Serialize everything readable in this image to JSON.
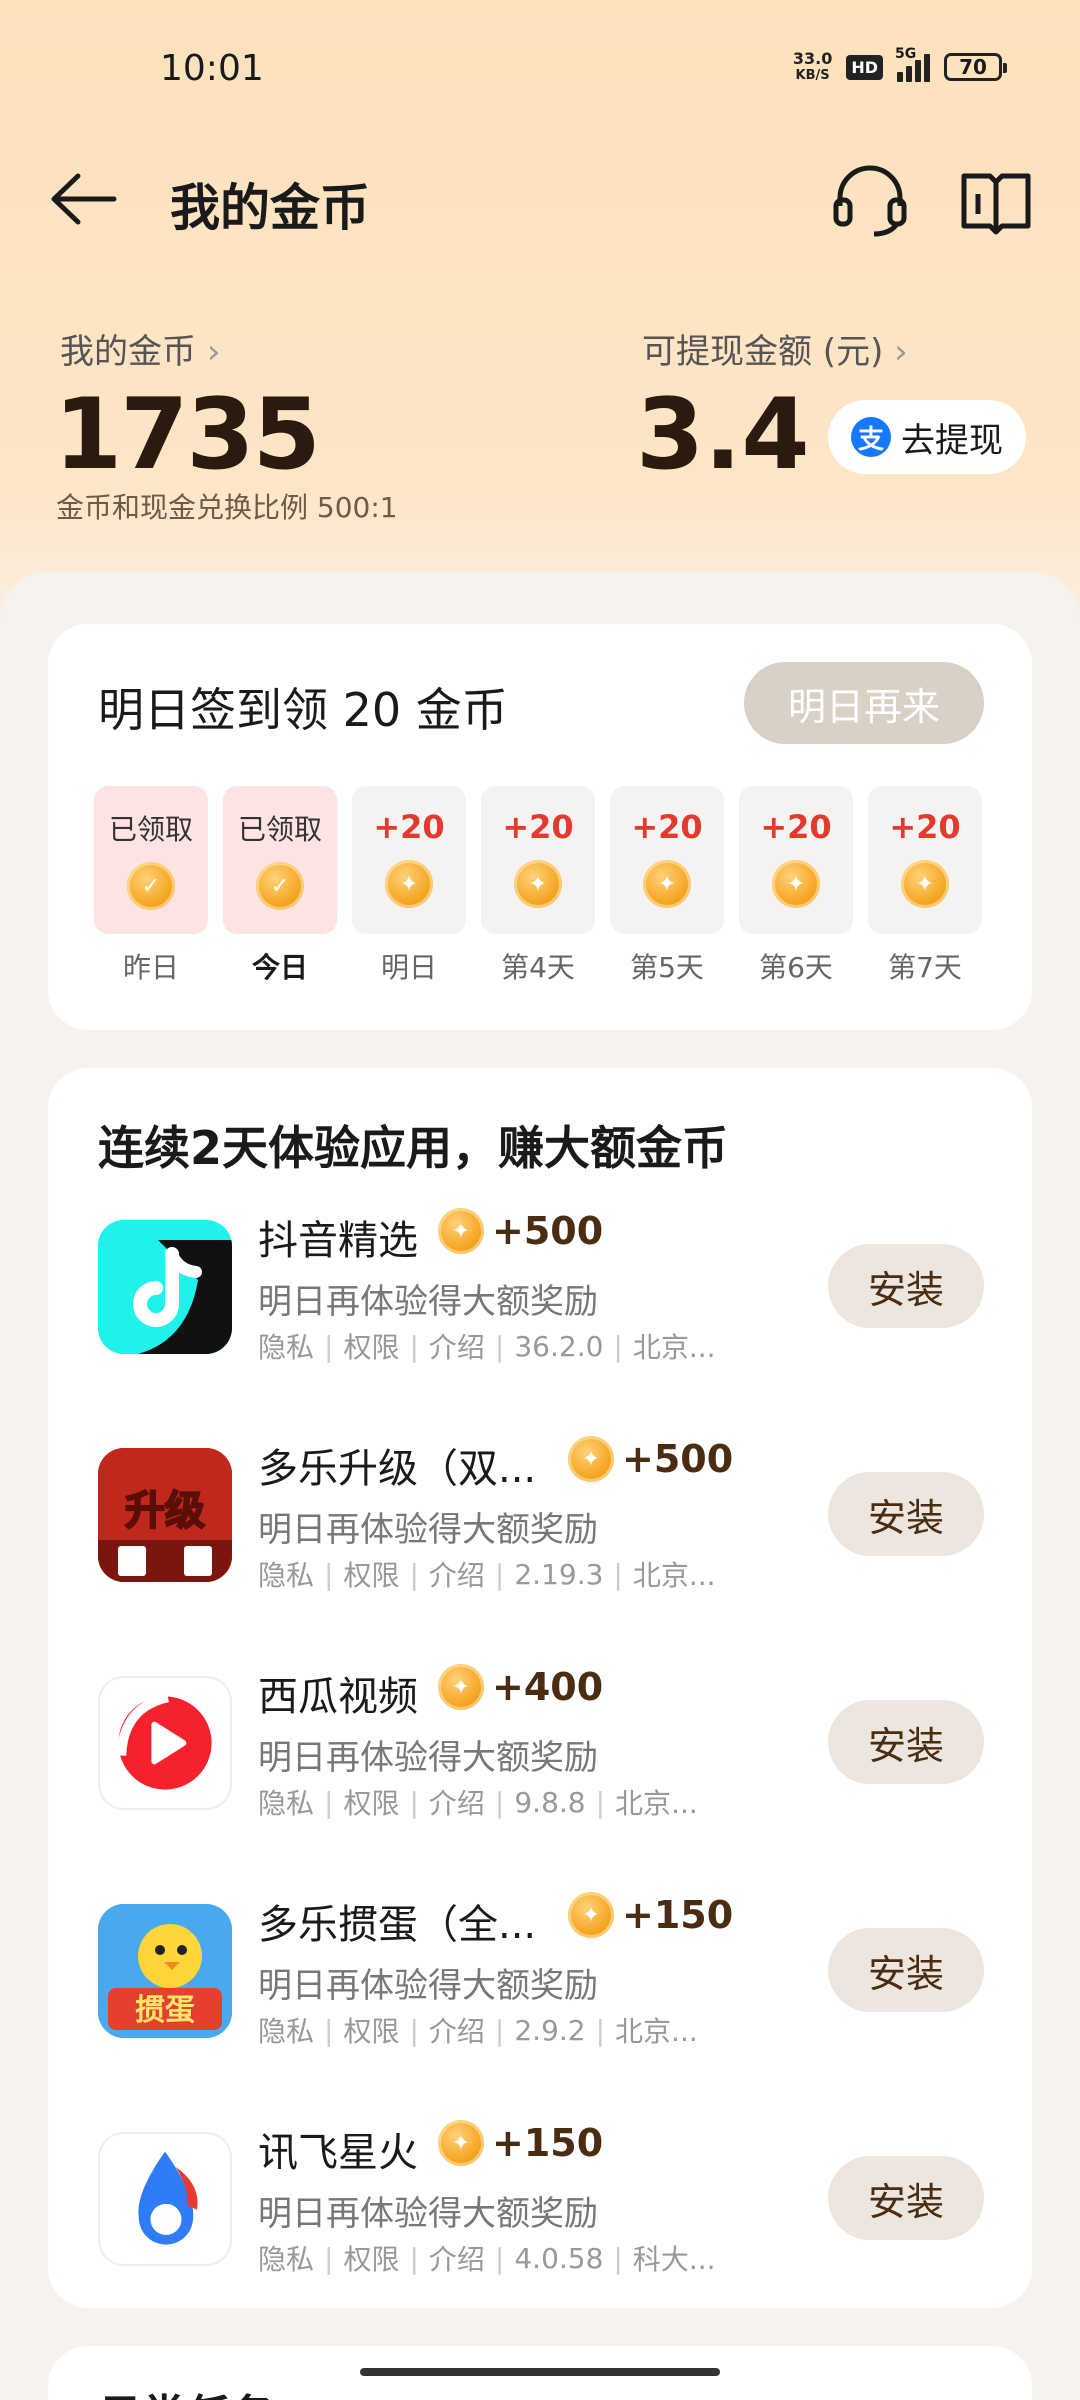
{
  "status_bar": {
    "time": "10:01",
    "net_speed_value": "33.0",
    "net_speed_unit": "KB/S",
    "hd": "HD",
    "network": "5G",
    "battery": "70"
  },
  "header": {
    "title": "我的金币"
  },
  "balance": {
    "coin_label": "我的金币",
    "coin_value": "1735",
    "ratio_text": "金币和现金兑换比例 500:1",
    "cash_label": "可提现金额 (元)",
    "cash_value": "3.4",
    "withdraw_label": "去提现",
    "alipay_glyph": "支"
  },
  "signin": {
    "title": "明日签到领 20 金币",
    "button_label": "明日再来",
    "days": [
      {
        "status": "已领取",
        "label": "昨日",
        "claimed": true
      },
      {
        "status": "已领取",
        "label": "今日",
        "claimed": true
      },
      {
        "status": "+20",
        "label": "明日",
        "claimed": false
      },
      {
        "status": "+20",
        "label": "第4天",
        "claimed": false
      },
      {
        "status": "+20",
        "label": "第5天",
        "claimed": false
      },
      {
        "status": "+20",
        "label": "第6天",
        "claimed": false
      },
      {
        "status": "+20",
        "label": "第7天",
        "claimed": false
      }
    ]
  },
  "apps_section": {
    "title": "连续2天体验应用，赚大额金币",
    "items": [
      {
        "name": "抖音精选",
        "reward": "+500",
        "desc": "明日再体验得大额奖励",
        "meta": [
          "隐私",
          "权限",
          "介绍",
          "36.2.0",
          "北京..."
        ],
        "install": "安装"
      },
      {
        "name": "多乐升级（双...",
        "reward": "+500",
        "desc": "明日再体验得大额奖励",
        "meta": [
          "隐私",
          "权限",
          "介绍",
          "2.19.3",
          "北京..."
        ],
        "install": "安装"
      },
      {
        "name": "西瓜视频",
        "reward": "+400",
        "desc": "明日再体验得大额奖励",
        "meta": [
          "隐私",
          "权限",
          "介绍",
          "9.8.8",
          "北京..."
        ],
        "install": "安装"
      },
      {
        "name": "多乐掼蛋（全...",
        "reward": "+150",
        "desc": "明日再体验得大额奖励",
        "meta": [
          "隐私",
          "权限",
          "介绍",
          "2.9.2",
          "北京..."
        ],
        "install": "安装"
      },
      {
        "name": "讯飞星火",
        "reward": "+150",
        "desc": "明日再体验得大额奖励",
        "meta": [
          "隐私",
          "权限",
          "介绍",
          "4.0.58",
          "科大..."
        ],
        "install": "安装"
      }
    ]
  },
  "icon_glyphs": {
    "shengji": "升级",
    "guandan": "掼蛋"
  },
  "next_section": {
    "title": "日常任务"
  }
}
